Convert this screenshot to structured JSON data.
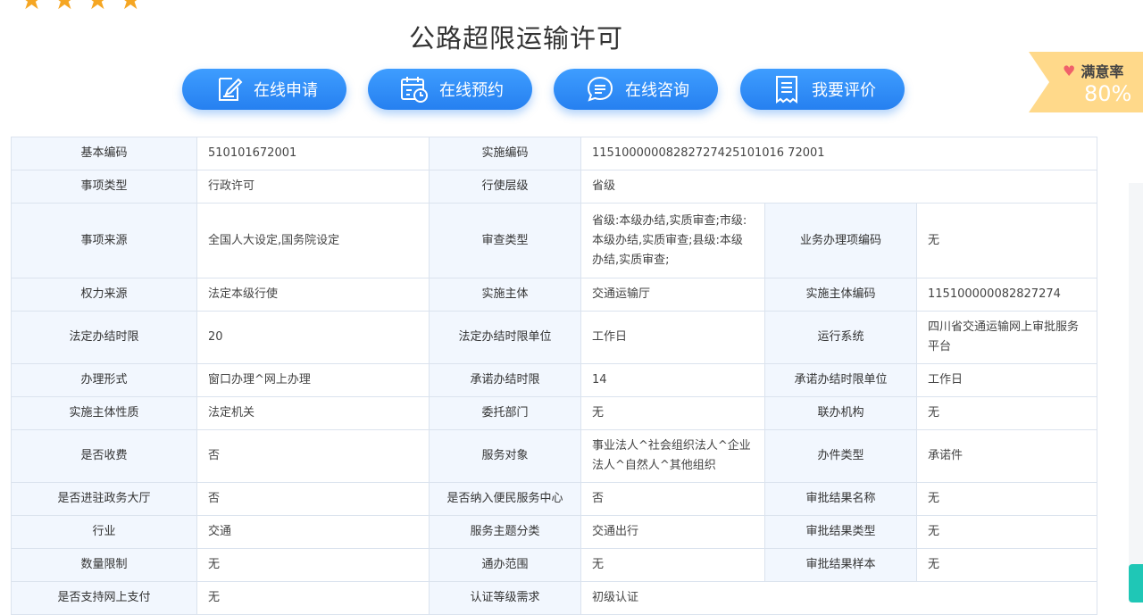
{
  "header": {
    "title": "公路超限运输许可",
    "stars": [
      "★",
      "★",
      "★",
      "★"
    ]
  },
  "actions": [
    {
      "label": "在线申请",
      "icon": "edit-document-icon"
    },
    {
      "label": "在线预约",
      "icon": "calendar-clock-icon"
    },
    {
      "label": "在线咨询",
      "icon": "chat-bubble-icon"
    },
    {
      "label": "我要评价",
      "icon": "receipt-list-icon"
    }
  ],
  "satisfaction": {
    "label": "满意率",
    "value": "80%"
  },
  "details": {
    "r1": {
      "k1": "基本编码",
      "v1": "510101672001",
      "k2": "实施编码",
      "v2": "11510000008282727425101016 72001"
    },
    "r2": {
      "k1": "事项类型",
      "v1": "行政许可",
      "k2": "行使层级",
      "v2": "省级"
    },
    "r3": {
      "k1": "事项来源",
      "v1": "全国人大设定,国务院设定",
      "k2": "审查类型",
      "v2": "省级:本级办结,实质审查;市级:本级办结,实质审查;县级:本级办结,实质审查;",
      "k3": "业务办理项编码",
      "v3": "无"
    },
    "r4": {
      "k1": "权力来源",
      "v1": "法定本级行使",
      "k2": "实施主体",
      "v2": "交通运输厅",
      "k3": "实施主体编码",
      "v3": "115100000082827274"
    },
    "r5": {
      "k1": "法定办结时限",
      "v1": "20",
      "k2": "法定办结时限单位",
      "v2": "工作日",
      "k3": "运行系统",
      "v3": "四川省交通运输网上审批服务平台"
    },
    "r6": {
      "k1": "办理形式",
      "v1": "窗口办理^网上办理",
      "k2": "承诺办结时限",
      "v2": "14",
      "k3": "承诺办结时限单位",
      "v3": "工作日"
    },
    "r7": {
      "k1": "实施主体性质",
      "v1": "法定机关",
      "k2": "委托部门",
      "v2": "无",
      "k3": "联办机构",
      "v3": "无"
    },
    "r8": {
      "k1": "是否收费",
      "v1": "否",
      "k2": "服务对象",
      "v2": "事业法人^社会组织法人^企业法人^自然人^其他组织",
      "k3": "办件类型",
      "v3": "承诺件"
    },
    "r9": {
      "k1": "是否进驻政务大厅",
      "v1": "否",
      "k2": "是否纳入便民服务中心",
      "v2": "否",
      "k3": "审批结果名称",
      "v3": "无"
    },
    "r10": {
      "k1": "行业",
      "v1": "交通",
      "k2": "服务主题分类",
      "v2": "交通出行",
      "k3": "审批结果类型",
      "v3": "无"
    },
    "r11": {
      "k1": "数量限制",
      "v1": "无",
      "k2": "通办范围",
      "v2": "无",
      "k3": "审批结果样本",
      "v3": "无"
    },
    "r12": {
      "k1": "是否支持网上支付",
      "v1": "无",
      "k2": "认证等级需求",
      "v2": "初级认证"
    }
  },
  "colors": {
    "accent": "#2680f0",
    "label_bg": "#f2f7fe",
    "badge": "#ffd98a",
    "star": "#f5a623"
  }
}
